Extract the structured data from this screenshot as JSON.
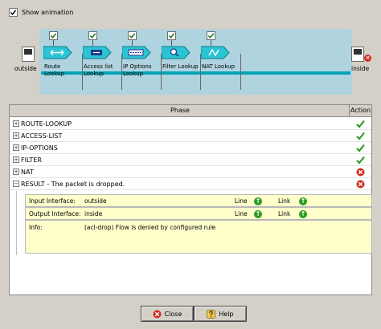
{
  "show_animation": {
    "label": "Show animation",
    "checked": true
  },
  "interfaces": {
    "input": "outside",
    "output": "inside"
  },
  "stages": [
    {
      "label": "Route\nLookup",
      "icon": "route-icon",
      "checked": true
    },
    {
      "label": "Access list\nLookup",
      "icon": "access-list-icon",
      "checked": true
    },
    {
      "label": "IP Options\nLookup",
      "icon": "ip-options-icon",
      "checked": true
    },
    {
      "label": "Filter Lookup",
      "icon": "filter-icon",
      "checked": true
    },
    {
      "label": "NAT Lookup",
      "icon": "nat-icon",
      "checked": true
    }
  ],
  "table": {
    "header_phase": "Phase",
    "header_action": "Action",
    "rows": [
      {
        "label": "ROUTE-LOOKUP",
        "expand": "+",
        "action": "allow"
      },
      {
        "label": "ACCESS-LIST",
        "expand": "+",
        "action": "allow"
      },
      {
        "label": "IP-OPTIONS",
        "expand": "+",
        "action": "allow"
      },
      {
        "label": "FILTER",
        "expand": "+",
        "action": "allow"
      },
      {
        "label": "NAT",
        "expand": "+",
        "action": "drop"
      },
      {
        "label": "RESULT - The packet is dropped.",
        "expand": "−",
        "action": "drop"
      }
    ]
  },
  "result": {
    "input_key": "Input Interface:",
    "input_value": "outside",
    "output_key": "Output Interface:",
    "output_value": "inside",
    "line_label": "Line",
    "link_label": "Link",
    "info_key": "Info:",
    "info_value": "(acl-drop) Flow is denied by configured rule"
  },
  "buttons": {
    "close": "Close",
    "help": "Help"
  },
  "colors": {
    "allow": "#2f9b24",
    "drop": "#d22a1e",
    "pipeline_bg": "#afd3df",
    "line": "#00a4b5"
  }
}
